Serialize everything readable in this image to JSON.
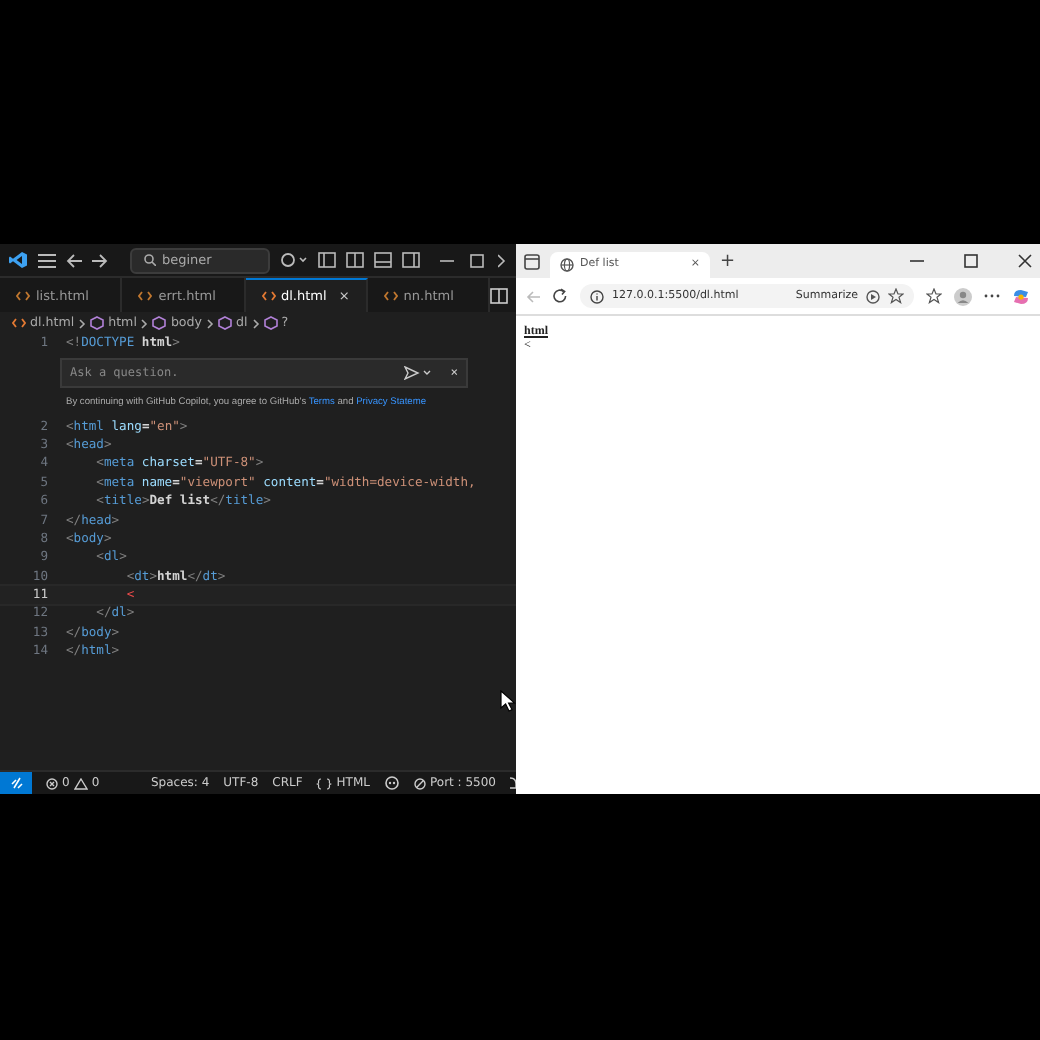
{
  "editor": {
    "search": {
      "value": "beginer"
    },
    "tabs": [
      {
        "label": "list.html",
        "selected": false
      },
      {
        "label": "errt.html",
        "selected": false
      },
      {
        "label": "dl.html",
        "selected": true,
        "close": "×"
      },
      {
        "label": "nn.html",
        "selected": false
      }
    ],
    "breadcrumb": [
      "dl.html",
      "html",
      "body",
      "dl",
      "?"
    ],
    "first_line": {
      "number": "1",
      "tokens": [
        {
          "kind": "punct",
          "text": "<!"
        },
        {
          "kind": "tag",
          "text": "DOCTYPE"
        },
        {
          "kind": "text",
          "text": " html"
        },
        {
          "kind": "punct",
          "text": ">"
        }
      ]
    },
    "chat": {
      "placeholder": "Ask a question.",
      "close": "×",
      "notice": {
        "before": "By continuing with GitHub Copilot, you agree to GitHub's ",
        "link1": "Terms",
        "middle": " and ",
        "link2": "Privacy Stateme"
      }
    },
    "lines": [
      {
        "number": "2",
        "selected": false,
        "tokens": [
          {
            "kind": "punct",
            "text": "<"
          },
          {
            "kind": "tag",
            "text": "html"
          },
          {
            "kind": "attr",
            "text": " lang"
          },
          {
            "kind": "text",
            "text": "="
          },
          {
            "kind": "str",
            "text": "\"en\""
          },
          {
            "kind": "punct",
            "text": ">"
          }
        ]
      },
      {
        "number": "3",
        "selected": false,
        "tokens": [
          {
            "kind": "punct",
            "text": "<"
          },
          {
            "kind": "tag",
            "text": "head"
          },
          {
            "kind": "punct",
            "text": ">"
          }
        ]
      },
      {
        "number": "4",
        "selected": false,
        "tokens": [
          {
            "kind": "punct",
            "text": "    <"
          },
          {
            "kind": "tag",
            "text": "meta"
          },
          {
            "kind": "attr",
            "text": " charset"
          },
          {
            "kind": "text",
            "text": "="
          },
          {
            "kind": "str",
            "text": "\"UTF-8\""
          },
          {
            "kind": "punct",
            "text": ">"
          }
        ]
      },
      {
        "number": "5",
        "selected": false,
        "tokens": [
          {
            "kind": "punct",
            "text": "    <"
          },
          {
            "kind": "tag",
            "text": "meta"
          },
          {
            "kind": "attr",
            "text": " name"
          },
          {
            "kind": "text",
            "text": "="
          },
          {
            "kind": "str",
            "text": "\"viewport\""
          },
          {
            "kind": "attr",
            "text": " content"
          },
          {
            "kind": "text",
            "text": "="
          },
          {
            "kind": "str",
            "text": "\"width=device-width,"
          }
        ]
      },
      {
        "number": "6",
        "selected": false,
        "tokens": [
          {
            "kind": "punct",
            "text": "    <"
          },
          {
            "kind": "tag",
            "text": "title"
          },
          {
            "kind": "punct",
            "text": ">"
          },
          {
            "kind": "text",
            "text": "Def list"
          },
          {
            "kind": "punct",
            "text": "</"
          },
          {
            "kind": "tag",
            "text": "title"
          },
          {
            "kind": "punct",
            "text": ">"
          }
        ]
      },
      {
        "number": "7",
        "selected": false,
        "tokens": [
          {
            "kind": "punct",
            "text": "</"
          },
          {
            "kind": "tag",
            "text": "head"
          },
          {
            "kind": "punct",
            "text": ">"
          }
        ]
      },
      {
        "number": "8",
        "selected": false,
        "tokens": [
          {
            "kind": "punct",
            "text": "<"
          },
          {
            "kind": "tag",
            "text": "body"
          },
          {
            "kind": "punct",
            "text": ">"
          }
        ]
      },
      {
        "number": "9",
        "selected": false,
        "tokens": [
          {
            "kind": "punct",
            "text": "    <"
          },
          {
            "kind": "tag",
            "text": "dl"
          },
          {
            "kind": "punct",
            "text": ">"
          }
        ]
      },
      {
        "number": "10",
        "selected": false,
        "tokens": [
          {
            "kind": "punct",
            "text": "        <"
          },
          {
            "kind": "tag",
            "text": "dt"
          },
          {
            "kind": "punct",
            "text": ">"
          },
          {
            "kind": "text",
            "text": "html"
          },
          {
            "kind": "punct",
            "text": "</"
          },
          {
            "kind": "tag",
            "text": "dt"
          },
          {
            "kind": "punct",
            "text": ">"
          }
        ]
      },
      {
        "number": "11",
        "selected": true,
        "tokens": [
          {
            "kind": "error",
            "text": "        <"
          }
        ]
      },
      {
        "number": "12",
        "selected": false,
        "tokens": [
          {
            "kind": "punct",
            "text": "    </"
          },
          {
            "kind": "tag",
            "text": "dl"
          },
          {
            "kind": "punct",
            "text": ">"
          }
        ]
      },
      {
        "number": "13",
        "selected": false,
        "tokens": [
          {
            "kind": "punct",
            "text": "</"
          },
          {
            "kind": "tag",
            "text": "body"
          },
          {
            "kind": "punct",
            "text": ">"
          }
        ]
      },
      {
        "number": "14",
        "selected": false,
        "tokens": [
          {
            "kind": "punct",
            "text": "</"
          },
          {
            "kind": "tag",
            "text": "html"
          },
          {
            "kind": "punct",
            "text": ">"
          }
        ]
      }
    ],
    "status_bar": {
      "errors": "0",
      "warnings": "0",
      "spaces": "Spaces: 4",
      "encoding": "UTF-8",
      "eol": "CRLF",
      "language": "HTML",
      "port": "Port : 5500"
    }
  },
  "browser": {
    "tabs": [
      {
        "label": "Def list",
        "selected": true,
        "close": "×"
      }
    ],
    "new_tab": "+",
    "address": "127.0.0.1:5500/dl.html",
    "summarize": "Summarize",
    "content": [
      "html",
      "<"
    ]
  }
}
